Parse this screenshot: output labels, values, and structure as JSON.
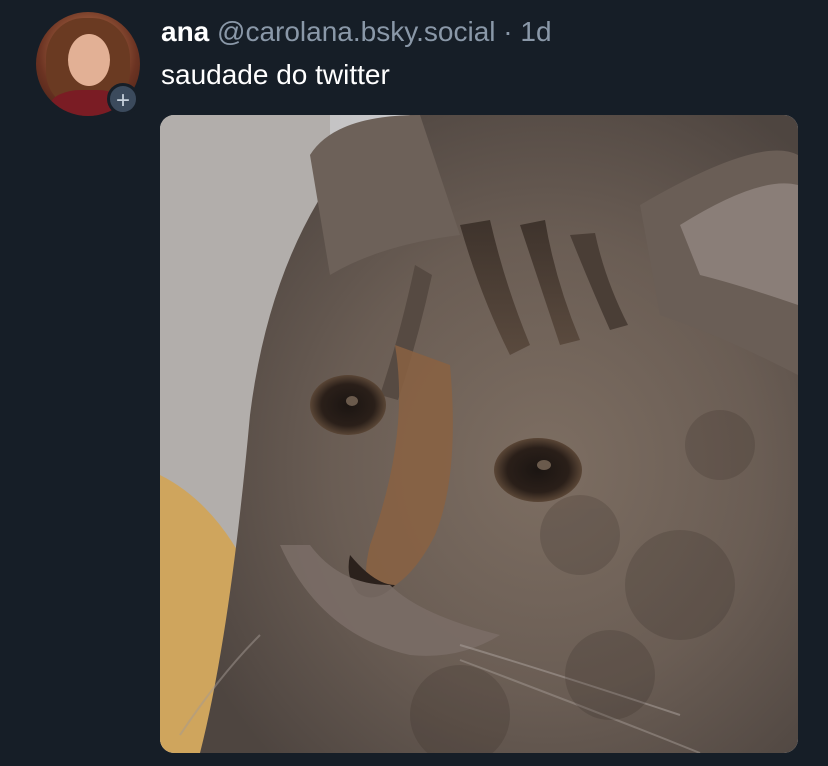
{
  "post": {
    "author": {
      "display_name": "ana",
      "handle": "@carolana.bsky.social",
      "avatar_icon": "avatar-photo"
    },
    "separator": "·",
    "timestamp": "1d",
    "follow_badge_icon": "plus-icon",
    "follow_badge_glyph": "+",
    "text": "saudade do twitter",
    "media": {
      "type": "image",
      "subject_icon": "cat-photo"
    }
  },
  "colors": {
    "background": "#161e27",
    "text_primary": "#ffffff",
    "text_secondary": "#8a98a8",
    "badge": "#3b4a5c"
  }
}
